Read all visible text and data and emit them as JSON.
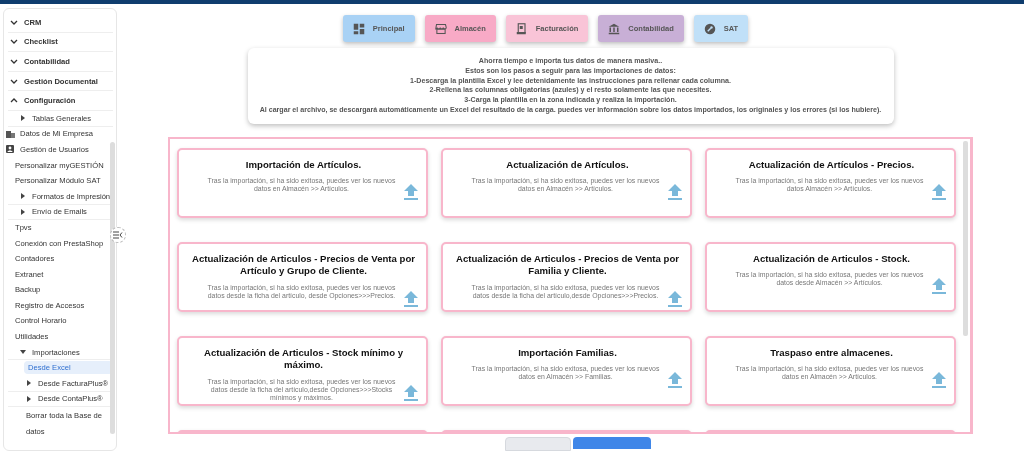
{
  "sidebar": {
    "items": [
      {
        "label": "CRM",
        "kind": "group",
        "expanded": false
      },
      {
        "label": "Checklist",
        "kind": "group",
        "expanded": false
      },
      {
        "label": "Contabilidad",
        "kind": "group",
        "expanded": false
      },
      {
        "label": "Gestión Documental",
        "kind": "group",
        "expanded": false
      },
      {
        "label": "Configuración",
        "kind": "group",
        "expanded": true,
        "children": [
          {
            "label": "Tablas Generales",
            "kind": "branch",
            "expanded": false
          },
          {
            "label": "Datos de Mi Empresa",
            "kind": "company"
          },
          {
            "label": "Gestión de Usuarios",
            "kind": "users"
          },
          {
            "label": "Personalizar myGESTIÓN",
            "kind": "link"
          },
          {
            "label": "Personalizar Módulo SAT",
            "kind": "link"
          },
          {
            "label": "Formatos de Impresión",
            "kind": "branch",
            "expanded": false
          },
          {
            "label": "Envío de Emails",
            "kind": "branch",
            "expanded": false
          },
          {
            "label": "Tpvs",
            "kind": "link"
          },
          {
            "label": "Conexión con PrestaShop",
            "kind": "link"
          },
          {
            "label": "Contadores",
            "kind": "link"
          },
          {
            "label": "Extranet",
            "kind": "link"
          },
          {
            "label": "Backup",
            "kind": "link"
          },
          {
            "label": "Registro de Accesos",
            "kind": "link"
          },
          {
            "label": "Control Horario",
            "kind": "link"
          },
          {
            "label": "Utilidades",
            "kind": "link"
          },
          {
            "label": "Importaciones",
            "kind": "branch",
            "expanded": true,
            "children": [
              {
                "label": "Desde Excel",
                "kind": "link",
                "selected": true
              },
              {
                "label": "Desde FacturaPlus®",
                "kind": "branch",
                "expanded": false
              },
              {
                "label": "Desde ContaPlus®",
                "kind": "branch",
                "expanded": false
              },
              {
                "label": "Borrar toda la Base de datos",
                "kind": "link",
                "selected": false
              }
            ]
          }
        ]
      }
    ]
  },
  "modules": [
    {
      "label": "Principal",
      "color": "#a9d2f5"
    },
    {
      "label": "Almacén",
      "color": "#f8aac6"
    },
    {
      "label": "Facturación",
      "color": "#f9c4d7"
    },
    {
      "label": "Contabilidad",
      "color": "#c8afd6"
    },
    {
      "label": "SAT",
      "color": "#c0e0f8"
    }
  ],
  "info": {
    "lines": [
      "Ahorra tiempo e importa tus datos de manera masiva..",
      "Estos son los pasos a seguir para las importaciones de datos:",
      "1-Descarga la plantilla Excel y lee detenidamente las instrucciones para rellenar cada columna.",
      "2-Rellena las columnas obligatorias (azules) y el resto solamente las que necesites.",
      "3-Carga la plantilla en la zona indicada y realiza la importación.",
      "Al cargar el archivo, se descargará automáticamente un Excel del resultado de la carga. puedes ver información sobre los datos importados, los originales y los errores (si los hubiere)."
    ]
  },
  "import_cards": [
    {
      "title": "Importación de Artículos.",
      "description": "Tras la importación, si ha sido exitosa, puedes ver los nuevos datos en Almacén >> Artículos."
    },
    {
      "title": "Actualización de Artículos.",
      "description": "Tras la importación, si ha sido exitosa, puedes ver los nuevos datos en Almacén >> Artículos."
    },
    {
      "title": "Actualización de Artículos - Precios.",
      "description": "Tras la importación, si ha sido exitosa, puedes ver los nuevos datos Almacén >> Artículos."
    },
    {
      "title": "Actualización de Articulos - Precios de Venta por Artículo y Grupo de Cliente.",
      "description": "Tras la importación, si ha sido exitosa, puedes ver los nuevos datos desde la ficha del artículo, desde Opciones>>>Precios."
    },
    {
      "title": "Actualización de Articulos - Precios de Venta por Familia y Cliente.",
      "description": "Tras la importación, si ha sido exitosa, puedes ver los nuevos datos desde la ficha del artículo,desde Opciones>>>Precios."
    },
    {
      "title": "Actualización de Articulos - Stock.",
      "description": "Tras la importación, si ha sido exitosa, puedes ver los nuevos datos desde Almacén >> Artículos."
    },
    {
      "title": "Actualización de Articulos - Stock mínimo y máximo.",
      "description": "Tras la importación, si ha sido exitosa, puedes ver los nuevos datos desde la ficha del artículo,desde Opciones>>>Stocks mínimos y máximos."
    },
    {
      "title": "Importación Familias.",
      "description": "Tras la importación, si ha sido exitosa, puedes ver los nuevos datos en Almacén >> Familias."
    },
    {
      "title": "Traspaso entre almacenes.",
      "description": "Tras la importación, si ha sido exitosa, puedes ver los nuevos datos en Almacén >> Artículos."
    }
  ]
}
